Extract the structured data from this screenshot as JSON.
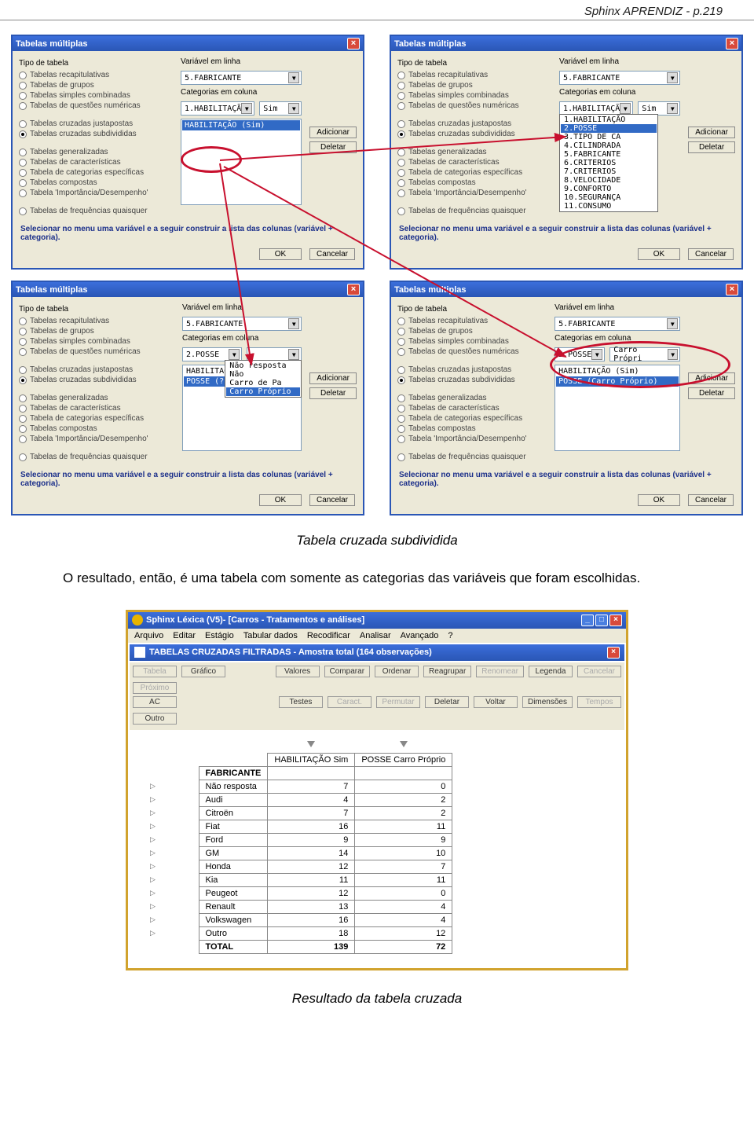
{
  "header": "Sphinx APRENDIZ - p.219",
  "dlg": {
    "title": "Tabelas múltiplas",
    "group_label": "Tipo de tabela",
    "radios": [
      "Tabelas recapitulativas",
      "Tabelas de grupos",
      "Tabelas simples combinadas",
      "Tabelas de questões numéricas",
      "Tabelas cruzadas justapostas",
      "Tabelas cruzadas subdivididas",
      "Tabelas generalizadas",
      "Tabelas de características",
      "Tabela de categorias específicas",
      "Tabelas compostas",
      "Tabela 'Importância/Desempenho'",
      "Tabelas de frequências quaisquer"
    ],
    "lbl_var_line": "Variável em linha",
    "lbl_cat_col": "Categorias em coluna",
    "val_fabricante": "5.FABRICANTE",
    "val_habil": "1.HABILITAÇÃ",
    "val_sim": "Sim",
    "list1_item": "HABILITAÇÃO (Sim)",
    "btn_add": "Adicionar",
    "btn_del": "Deletar",
    "note": "Selecionar no menu uma variável e a seguir construir a lista das colunas (variável + categoria).",
    "btn_ok": "OK",
    "btn_cancel": "Cancelar",
    "droplist": [
      "1.HABILITAÇÃO",
      "2.POSSE",
      "3.TIPO DE CA",
      "4.CILINDRADA",
      "5.FABRICANTE",
      "6.CRITERIOS",
      "7.CRITERIOS",
      "8.VELOCIDADE",
      "9.CONFORTO",
      "10.SEGURANÇA",
      "11.CONSUMO"
    ],
    "val_posse": "2.POSSE",
    "list3_a": "HABILITAÇÃO (Sim",
    "list3_b": "POSSE (???)",
    "drop3": [
      "Não resposta",
      "Não",
      "Carro de Pa",
      "Carro Próprio"
    ],
    "val_carro": "Carro Própri",
    "list4_a": "HABILITAÇÃO (Sim)",
    "list4_b": "POSSE (Carro Próprio)"
  },
  "caption1": "Tabela cruzada subdividida",
  "body_text": "O resultado, então, é uma tabela com somente as categorias das variáveis que foram escolhidas.",
  "win": {
    "title": "Sphinx Léxica (V5)- [Carros - Tratamentos e análises]",
    "menus": [
      "Arquivo",
      "Editar",
      "Estágio",
      "Tabular dados",
      "Recodificar",
      "Analisar",
      "Avançado",
      "?"
    ],
    "subtitle": "TABELAS CRUZADAS FILTRADAS - Amostra total (164 observações)",
    "tb_row1": [
      "Tabela",
      "Gráfico",
      "Valores",
      "Comparar",
      "Ordenar",
      "Reagrupar",
      "Renomear",
      "Legenda",
      "Cancelar",
      "Próximo"
    ],
    "tb_row2": [
      "AC",
      "Testes",
      "Caract.",
      "Permutar",
      "Deletar",
      "Voltar",
      "Dimensões",
      "Tempos",
      "Outro"
    ],
    "col1": "HABILITAÇÃO Sim",
    "col2": "POSSE Carro Próprio",
    "rowhdr": "FABRICANTE"
  },
  "chart_data": {
    "type": "table",
    "title": "TABELAS CRUZADAS FILTRADAS - Amostra total (164 observações)",
    "row_header": "FABRICANTE",
    "columns": [
      "HABILITAÇÃO Sim",
      "POSSE Carro Próprio"
    ],
    "rows": [
      {
        "label": "Não resposta",
        "values": [
          7,
          0
        ]
      },
      {
        "label": "Audi",
        "values": [
          4,
          2
        ]
      },
      {
        "label": "Citroën",
        "values": [
          7,
          2
        ]
      },
      {
        "label": "Fiat",
        "values": [
          16,
          11
        ]
      },
      {
        "label": "Ford",
        "values": [
          9,
          9
        ]
      },
      {
        "label": "GM",
        "values": [
          14,
          10
        ]
      },
      {
        "label": "Honda",
        "values": [
          12,
          7
        ]
      },
      {
        "label": "Kia",
        "values": [
          11,
          11
        ]
      },
      {
        "label": "Peugeot",
        "values": [
          12,
          0
        ]
      },
      {
        "label": "Renault",
        "values": [
          13,
          4
        ]
      },
      {
        "label": "Volkswagen",
        "values": [
          16,
          4
        ]
      },
      {
        "label": "Outro",
        "values": [
          18,
          12
        ]
      }
    ],
    "totals": {
      "label": "TOTAL",
      "values": [
        139,
        72
      ]
    }
  },
  "caption2": "Resultado da tabela cruzada"
}
